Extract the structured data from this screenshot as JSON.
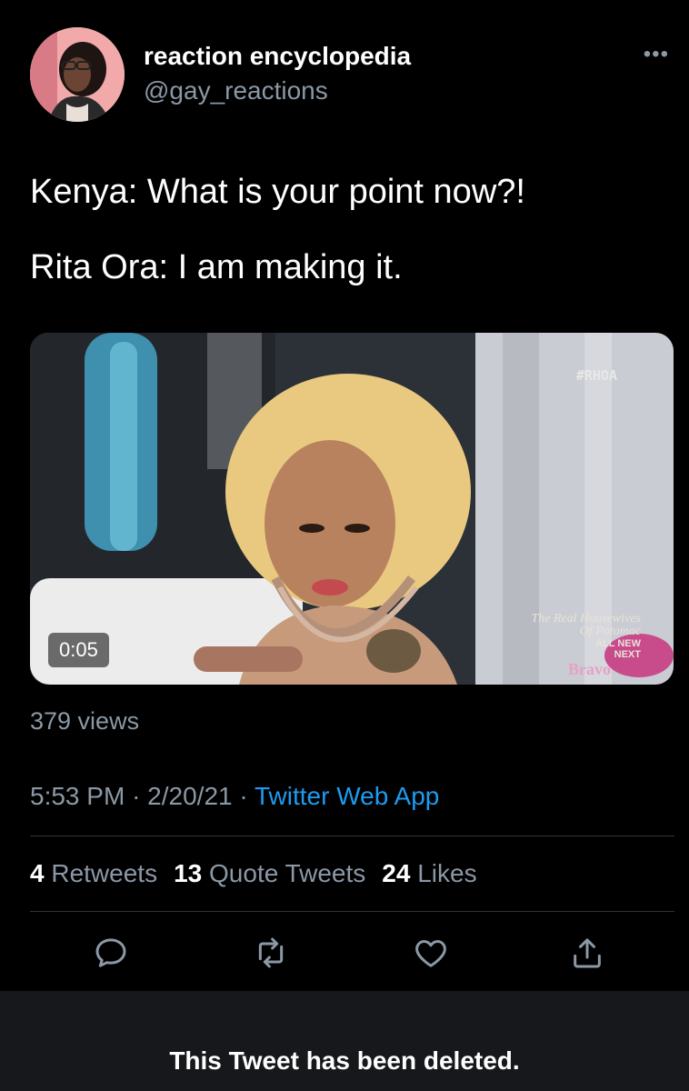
{
  "user": {
    "name": "reaction encyclopedia",
    "handle": "@gay_reactions",
    "more_icon": "more-horizontal-icon"
  },
  "tweet": {
    "lines": [
      "Kenya: What is your point now?!",
      "Rita Ora: I am making it."
    ]
  },
  "media": {
    "duration": "0:05",
    "hashtag": "#RHOA",
    "show_title": "The Real Housewives",
    "show_subtitle": "Of Potomac",
    "show_badge_1": "ALL NEW",
    "show_badge_2": "NEXT",
    "network": "Bravo"
  },
  "views": "379 views",
  "meta": {
    "time": "5:53 PM",
    "date": "2/20/21",
    "app": "Twitter Web App"
  },
  "stats": {
    "retweets_count": "4",
    "retweets_label": "Retweets",
    "quotes_count": "13",
    "quotes_label": "Quote Tweets",
    "likes_count": "24",
    "likes_label": "Likes"
  },
  "actions": [
    "reply-icon",
    "retweet-icon",
    "like-icon",
    "share-icon"
  ],
  "deleted_notice": "This Tweet has been deleted.",
  "colors": {
    "background": "#000000",
    "secondary_text": "#8b98a5",
    "link": "#1d9bf0",
    "divider": "#2f3336",
    "notice_bg": "#16181c"
  }
}
